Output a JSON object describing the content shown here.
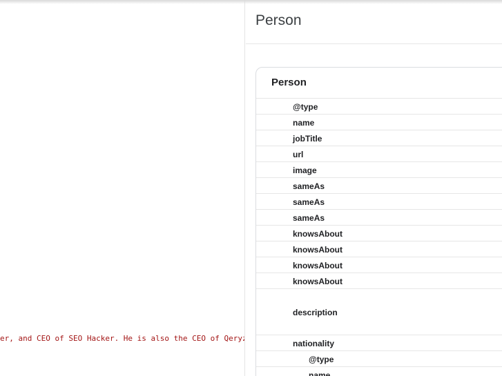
{
  "code_editor": {
    "visible_line": "er, and CEO of SEO Hacker. He is also the CEO of Qeryz,"
  },
  "result_panel": {
    "title": "Person",
    "card": {
      "title": "Person",
      "properties": [
        "@type",
        "name",
        "jobTitle",
        "url",
        "image",
        "sameAs",
        "sameAs",
        "sameAs",
        "knowsAbout",
        "knowsAbout",
        "knowsAbout",
        "knowsAbout",
        "description",
        "nationality",
        "@type",
        "name"
      ]
    }
  },
  "colors": {
    "string_literal": "#a31515",
    "border": "#e6e6e6"
  }
}
